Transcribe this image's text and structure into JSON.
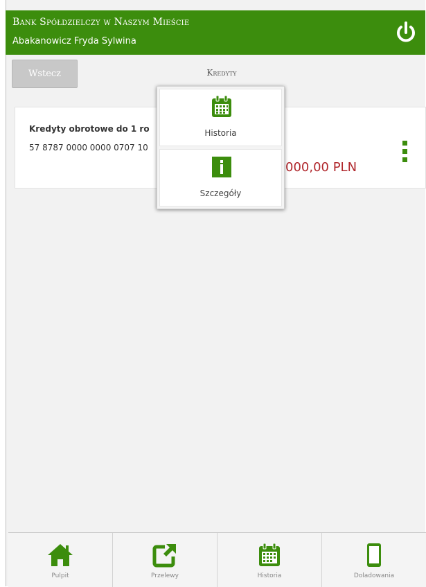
{
  "header": {
    "bank_name": "Bank Spółdzielczy w Naszym Mieście",
    "user_name": "Abakanowicz Fryda Sylwina",
    "power_icon": "power-icon"
  },
  "toolbar": {
    "back_label": "Wstecz",
    "page_title": "Kredyty"
  },
  "credit_card": {
    "title": "Kredyty obrotowe do 1 ro",
    "account": "57 8787 0000 0000 0707 10",
    "amount": "000,00 PLN",
    "menu_icon": "kebab-menu-icon"
  },
  "context_menu": {
    "items": [
      {
        "label": "Historia",
        "icon": "calendar-icon"
      },
      {
        "label": "Szczegóły",
        "icon": "info-icon"
      }
    ]
  },
  "bottom_nav": {
    "items": [
      {
        "label": "Pulpit",
        "icon": "home-icon"
      },
      {
        "label": "Przelewy",
        "icon": "transfer-icon"
      },
      {
        "label": "Historia",
        "icon": "calendar-icon"
      },
      {
        "label": "Doladowania",
        "icon": "phone-icon"
      }
    ]
  },
  "colors": {
    "brand_green": "#3c8d0d",
    "amount_red": "#b0272c"
  }
}
